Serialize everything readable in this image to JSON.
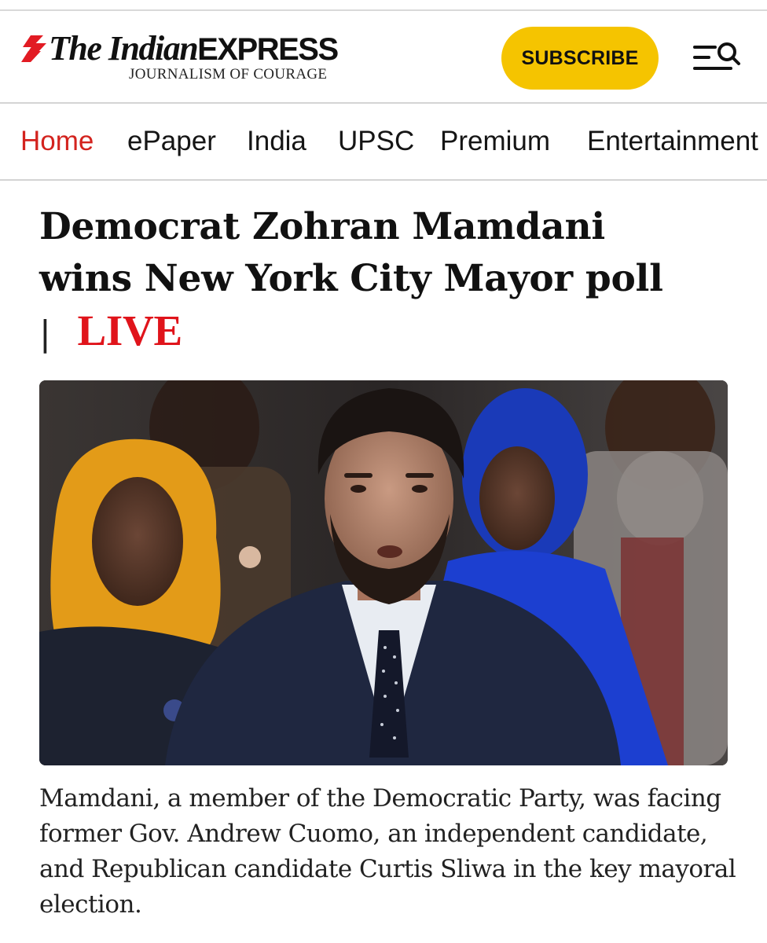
{
  "brand": {
    "title_part1": "The Indian",
    "title_part2": "EXPRESS",
    "tagline": "JOURNALISM OF COURAGE",
    "accent_color": "#d3231e"
  },
  "header": {
    "subscribe_label": "SUBSCRIBE",
    "subscribe_color": "#f5c400",
    "menu_icon": "menu-search-icon"
  },
  "nav": {
    "items": [
      {
        "label": "Home",
        "active": true
      },
      {
        "label": "ePaper"
      },
      {
        "label": "India"
      },
      {
        "label": "UPSC"
      },
      {
        "label": "Premium"
      },
      {
        "label": "Entertainment"
      }
    ]
  },
  "article": {
    "headline_line1": "Democrat Zohran Mamdani",
    "headline_line2": "wins New York City Mayor poll",
    "separator": "|",
    "live_label": "LIVE",
    "live_color": "#e0141b",
    "caption": "Mamdani, a member of the Democratic Party, was facing former Gov. Andrew Cuomo, an independent candidate, and Republican candidate Curtis Sliwa in the key mayoral election."
  }
}
